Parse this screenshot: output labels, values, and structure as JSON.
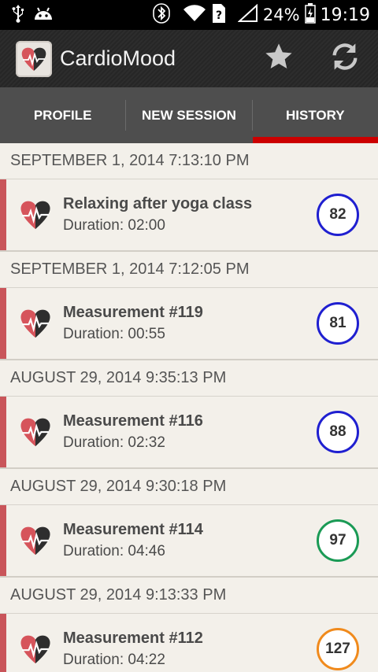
{
  "status_bar": {
    "battery_percent": "24%",
    "time": "19:19",
    "icons": [
      "usb-icon",
      "android-icon",
      "bluetooth-icon",
      "wifi-icon",
      "sim-unknown-icon",
      "signal-icon",
      "battery-charging-icon"
    ]
  },
  "app_bar": {
    "title": "CardioMood",
    "actions": [
      "star-icon",
      "refresh-icon"
    ]
  },
  "tabs": [
    {
      "label": "PROFILE",
      "active": false
    },
    {
      "label": "NEW SESSION",
      "active": false
    },
    {
      "label": "HISTORY",
      "active": true
    }
  ],
  "sessions": [
    {
      "date": "SEPTEMBER 1, 2014 7:13:10 PM",
      "title": "Relaxing after yoga class",
      "duration": "Duration: 02:00",
      "score": "82",
      "score_color": "#1f1fd0"
    },
    {
      "date": "SEPTEMBER 1, 2014 7:12:05 PM",
      "title": "Measurement #119",
      "duration": "Duration: 00:55",
      "score": "81",
      "score_color": "#1f1fd0"
    },
    {
      "date": "AUGUST 29, 2014 9:35:13 PM",
      "title": "Measurement #116",
      "duration": "Duration: 02:32",
      "score": "88",
      "score_color": "#1f1fd0"
    },
    {
      "date": "AUGUST 29, 2014 9:30:18 PM",
      "title": "Measurement #114",
      "duration": "Duration: 04:46",
      "score": "97",
      "score_color": "#1a9a55"
    },
    {
      "date": "AUGUST 29, 2014 9:13:33 PM",
      "title": "Measurement #112",
      "duration": "Duration: 04:22",
      "score": "127",
      "score_color": "#f08a1c"
    }
  ],
  "colors": {
    "tab_active_indicator": "#cc0000",
    "item_accent": "#c9555a",
    "tab_bar": "#4e4e4e",
    "background": "#f3f0ea"
  }
}
